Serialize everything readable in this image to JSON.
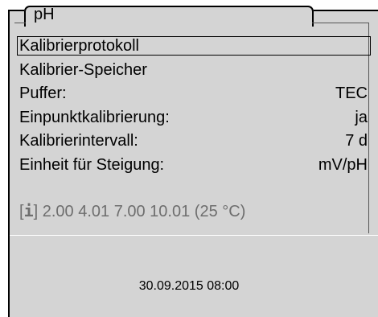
{
  "header": {
    "tab_title": "pH"
  },
  "menu": {
    "items": [
      {
        "label": "Kalibrierprotokoll",
        "value": ""
      },
      {
        "label": "Kalibrier-Speicher",
        "value": ""
      },
      {
        "label": "Puffer:",
        "value": "TEC"
      },
      {
        "label": "Einpunktkalibrierung:",
        "value": "ja"
      },
      {
        "label": "Kalibrierintervall:",
        "value": "7 d"
      },
      {
        "label": "Einheit für Steigung:",
        "value": "mV/pH"
      }
    ]
  },
  "info": {
    "bracket_open": "[",
    "icon_glyph": "i",
    "bracket_close": "]",
    "buffer_values": "2.00 4.01 7.00 10.01 (25 °C)",
    "icon": "info-icon"
  },
  "status": {
    "datetime": "30.09.2015 08:00"
  }
}
